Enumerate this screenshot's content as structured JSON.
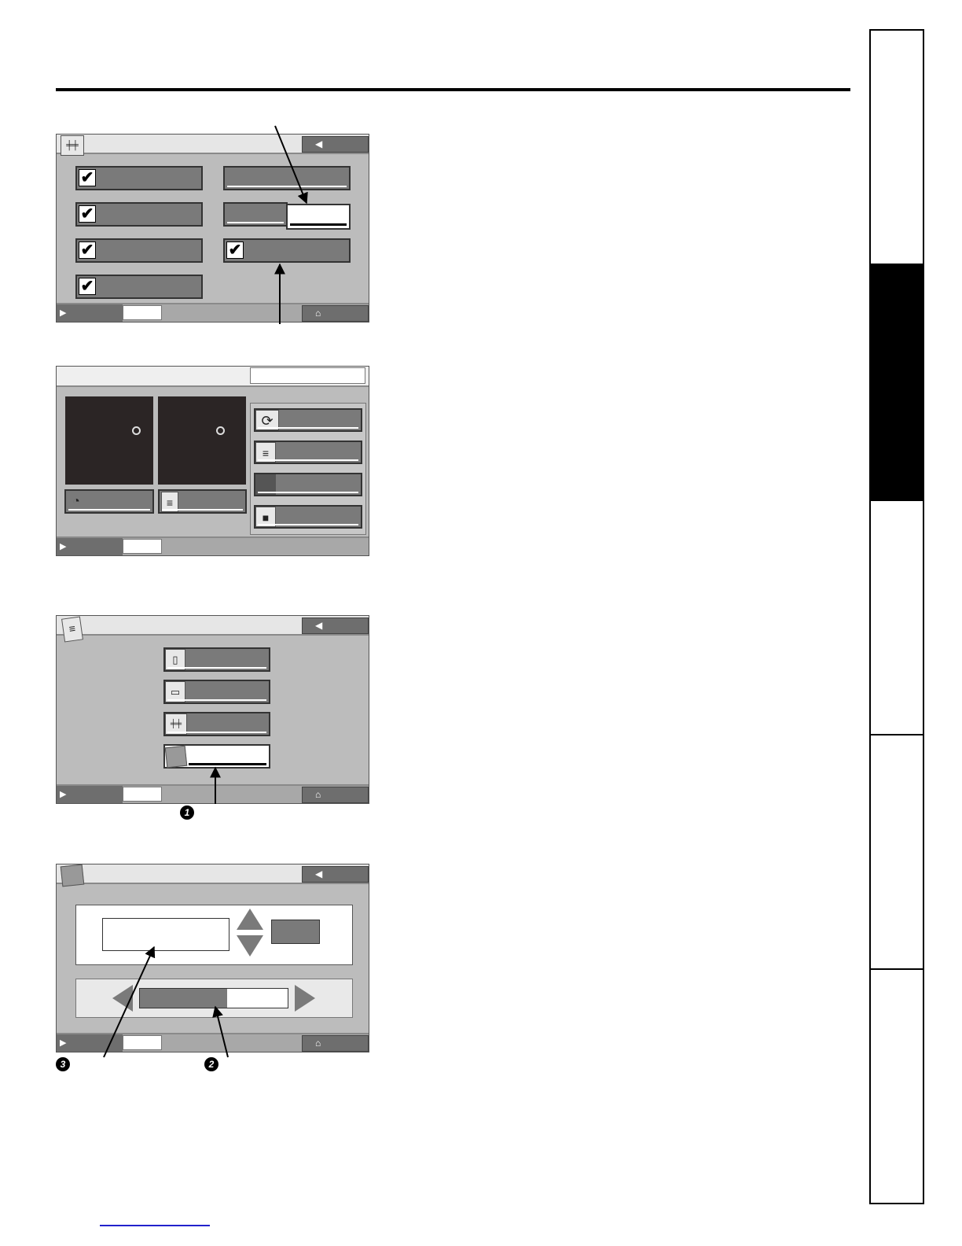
{
  "callouts": {
    "one": "1",
    "two": "2",
    "three": "3"
  },
  "icons": {
    "back": "◀",
    "home": "⌂",
    "play": "▶",
    "check": "✔",
    "settings": "╪╪",
    "refresh": "⟳"
  },
  "colors": {
    "screen_bg": "#bcbcbc",
    "button": "#7a7a7a",
    "active_tab": "#000000",
    "dark_panel": "#2b2525"
  }
}
